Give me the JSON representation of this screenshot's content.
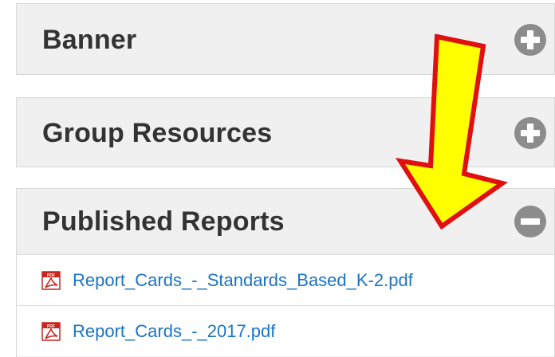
{
  "panels": {
    "banner": {
      "title": "Banner",
      "toggle_icon": "plus-circle-icon"
    },
    "group_resources": {
      "title": "Group Resources",
      "toggle_icon": "plus-circle-icon"
    },
    "published_reports": {
      "title": "Published Reports",
      "toggle_icon": "minus-circle-icon",
      "files": [
        {
          "name": "Report_Cards_-_Standards_Based_K-2.pdf",
          "icon": "pdf-icon"
        },
        {
          "name": "Report_Cards_-_2017.pdf",
          "icon": "pdf-icon"
        }
      ]
    }
  },
  "annotation": {
    "icon": "arrow-down-annotation",
    "fill_color": "#ffff00",
    "stroke_color": "#e01010"
  },
  "colors": {
    "link": "#1b74c5",
    "panel_bg": "#f0f0f0",
    "toggle_icon": "#8c8c8c"
  }
}
